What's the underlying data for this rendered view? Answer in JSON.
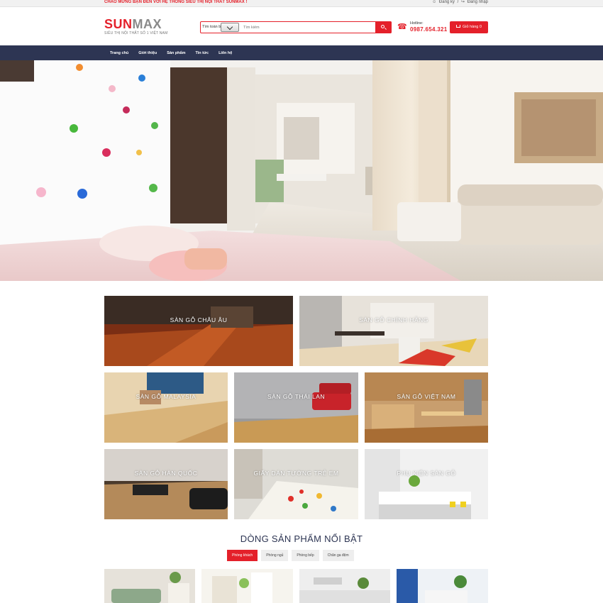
{
  "topbar": {
    "welcome": "CHÀO MỪNG BẠN ĐẾN VỚI HỆ THỐNG SIÊU THỊ NỘI THẤT SUNMAX !",
    "register": "Đăng ký",
    "separator": "/",
    "login": "Đăng nhập"
  },
  "header": {
    "logo_sun": "SUN",
    "logo_max": "MAX",
    "logo_tagline": "SIÊU THỊ NỘI THẤT SỐ 1 VIỆT NAM",
    "search_category": "Tìm toàn bộ",
    "search_placeholder": "Tìm kiếm",
    "hotline_label": "Hotline:",
    "hotline_number": "0987.654.321",
    "cart_label": "Giỏ hàng 0"
  },
  "nav": {
    "items": [
      "Trang chủ",
      "Giới thiệu",
      "Sản phẩm",
      "Tin tức",
      "Liên hệ"
    ]
  },
  "categories": [
    "SÀN GỖ CHÂU ÂU",
    "SÀN GỖ CHÍNH HÃNG",
    "SÀN GỖ MALAYSIA",
    "SÀN GỖ THÁI LAN",
    "SÀN GỖ VIỆT NAM",
    "SÀN GỖ HÀN QUỐC",
    "GIẤY DÁN TƯỜNG TRẺ EM",
    "PHỤ KIỆN SÀN GỖ"
  ],
  "featured": {
    "title": "DÒNG SẢN PHẨM NỔI BẬT",
    "tabs": [
      "Phòng khách",
      "Phòng ngủ",
      "Phòng bếp",
      "Chăn ga đệm"
    ],
    "active_tab": "Phòng khách"
  },
  "colors": {
    "accent": "#e4202a",
    "nav": "#2d3553"
  }
}
